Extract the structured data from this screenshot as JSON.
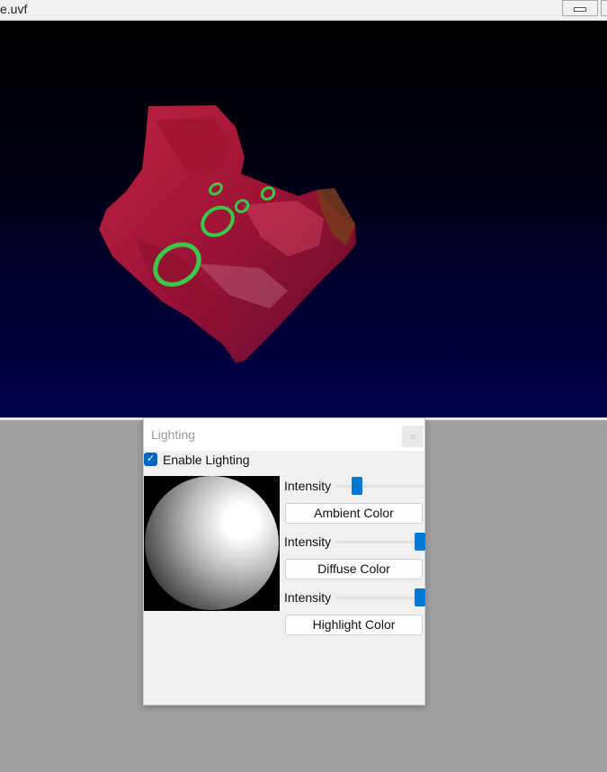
{
  "window": {
    "title": "e.uvf"
  },
  "dialog": {
    "title": "Lighting",
    "close_label": "×",
    "enable_label": "Enable Lighting",
    "enable_checked": true,
    "intensity_label": "Intensity",
    "ambient_button": "Ambient Color",
    "diffuse_button": "Diffuse Color",
    "highlight_button": "Highlight Color",
    "ambient_intensity": 0.18,
    "diffuse_intensity": 1.0,
    "highlight_intensity": 1.0
  },
  "colors": {
    "accent": "#0078d4",
    "volume_red": "#c2183a",
    "volume_green": "#39c84a",
    "background_top": "#000000",
    "background_bottom": "#00004a"
  }
}
